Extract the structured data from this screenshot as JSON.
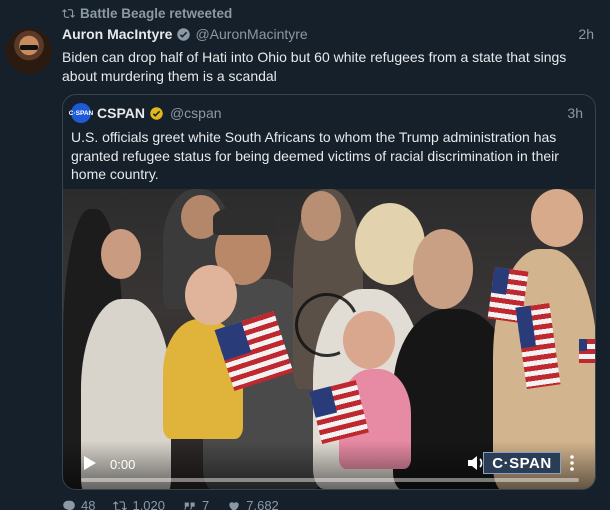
{
  "retweet": {
    "label": "Battle Beagle retweeted"
  },
  "tweet": {
    "author_name": "Auron MacIntyre",
    "author_handle": "@AuronMacintyre",
    "time": "2h",
    "text": "Biden can drop half of Hati into Ohio but 60 white refugees from a state that sings about murdering them is a scandal"
  },
  "quote": {
    "avatar_text": "C·SPAN",
    "author_name": "CSPAN",
    "author_handle": "@cspan",
    "time": "3h",
    "text": "U.S. officials greet white South Africans to whom the Trump administration has granted refugee status for being deemed victims of racial discrimination in their home country.",
    "video": {
      "current_time": "0:00",
      "logo_text": "C·SPAN",
      "progress": 0.0
    }
  },
  "actions": {
    "replies": "48",
    "retweets": "1,020",
    "quotes": "7",
    "likes": "7,682"
  },
  "colors": {
    "background": "#15202b",
    "text": "#e7e9ea",
    "muted": "#8b98a5",
    "verified_blue": "#1d9bf0",
    "verified_gold": "#e2b719"
  }
}
